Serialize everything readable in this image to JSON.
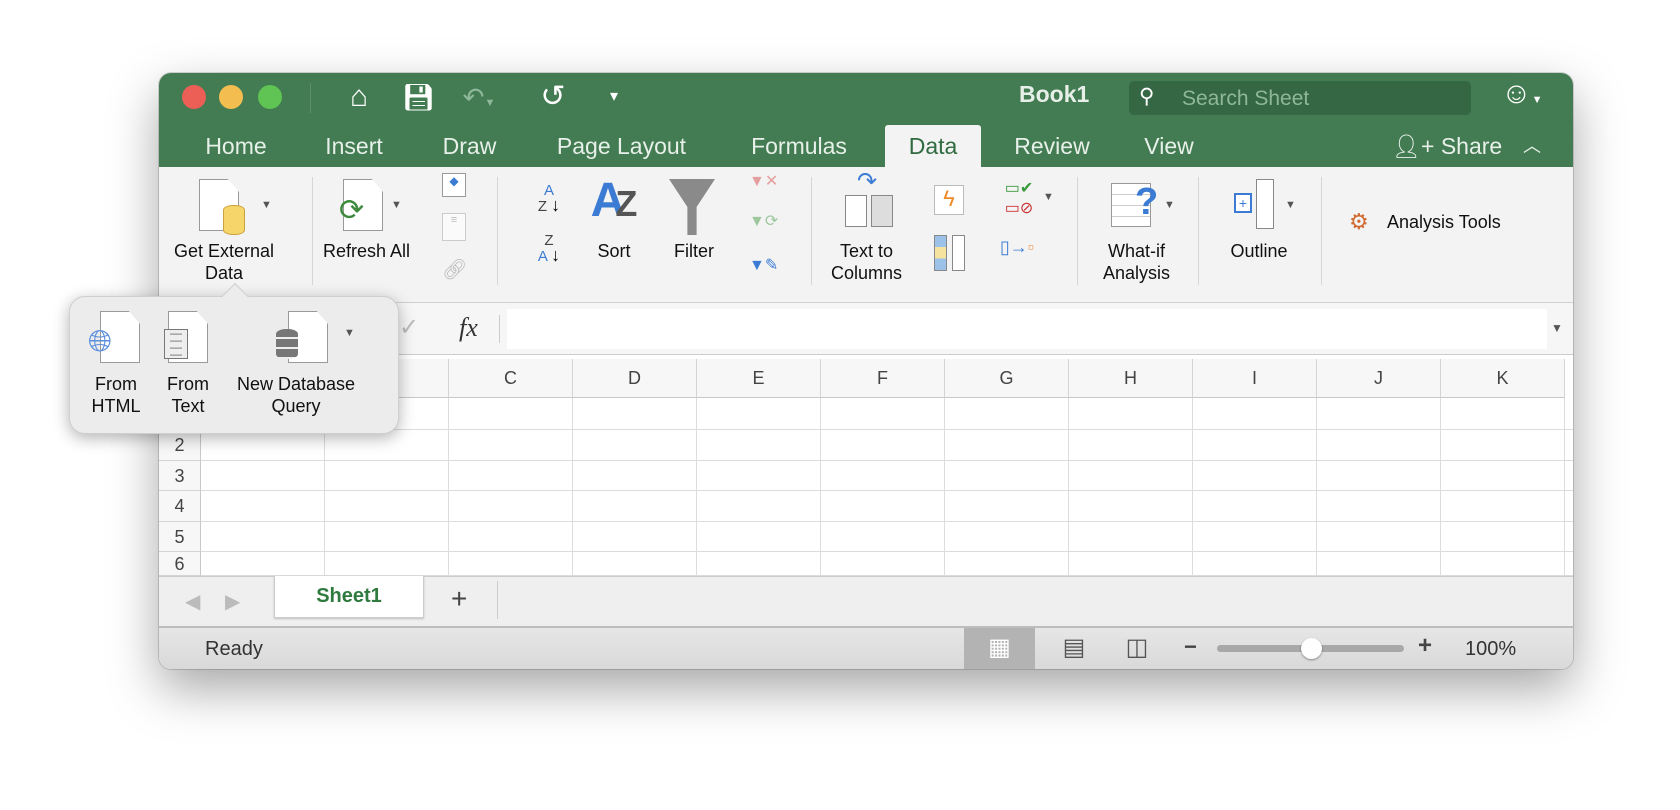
{
  "window": {
    "title": "Book1",
    "search_placeholder": "Search Sheet"
  },
  "toolbar": {
    "icons": [
      "home-icon",
      "save-icon",
      "undo-icon",
      "redo-icon",
      "customize-icon"
    ]
  },
  "tabs": [
    {
      "label": "Home"
    },
    {
      "label": "Insert"
    },
    {
      "label": "Draw"
    },
    {
      "label": "Page Layout"
    },
    {
      "label": "Formulas"
    },
    {
      "label": "Data",
      "active": true
    },
    {
      "label": "Review"
    },
    {
      "label": "View"
    }
  ],
  "share": {
    "label": "Share"
  },
  "ribbon": {
    "get_external_data": "Get External Data",
    "refresh_all": "Refresh All",
    "sort": "Sort",
    "filter": "Filter",
    "text_to_columns": "Text to Columns",
    "what_if": "What-if Analysis",
    "outline": "Outline",
    "analysis_tools": "Analysis Tools",
    "sort_az": "A Z",
    "sort_za": "Z A"
  },
  "formula_bar": {
    "fx": "fx",
    "value": ""
  },
  "popup": {
    "from_html": "From HTML",
    "from_text": "From Text",
    "new_db_query": "New Database Query"
  },
  "columns": [
    "C",
    "D",
    "E",
    "F",
    "G",
    "H",
    "I",
    "J",
    "K"
  ],
  "rows": [
    "2",
    "3",
    "4",
    "5",
    "6"
  ],
  "sheets": [
    {
      "name": "Sheet1",
      "active": true
    }
  ],
  "add_sheet": "+",
  "status": {
    "text": "Ready",
    "zoom": "100%",
    "zoom_minus": "−",
    "zoom_plus": "+",
    "zoom_level": 1.0
  },
  "colors": {
    "accent": "#437c52",
    "tab_text": "#2f6b3f"
  }
}
